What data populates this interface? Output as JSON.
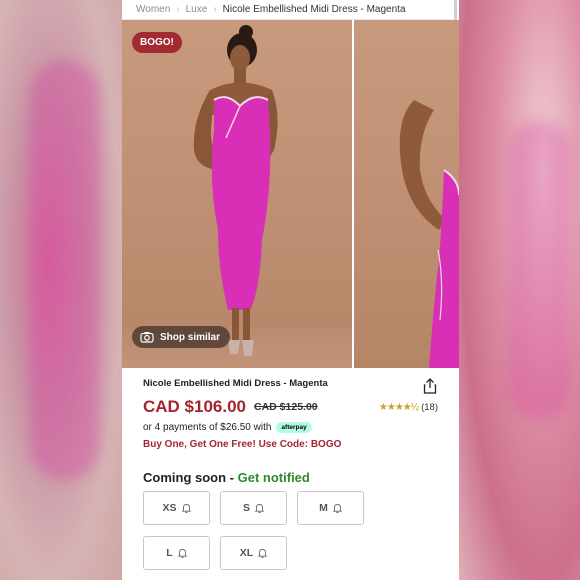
{
  "breadcrumb": {
    "items": [
      "Women",
      "Luxe"
    ],
    "current": "Nicole Embellished Midi Dress - Magenta"
  },
  "gallery": {
    "badge": "BOGO!",
    "shop_similar": "Shop similar"
  },
  "product": {
    "title": "Nicole Embellished Midi Dress - Magenta",
    "price": "CAD $106.00",
    "old_price": "CAD $125.00",
    "rating": 4.5,
    "reviews": "(18)",
    "installments_text": "or 4 payments of $26.50 with",
    "afterpay_label": "afterpay",
    "promo": "Buy One, Get One Free! Use Code: BOGO"
  },
  "availability": {
    "coming_soon": "Coming soon",
    "separator": "-",
    "get_notified": "Get notified"
  },
  "sizes": [
    "XS",
    "S",
    "M",
    "L",
    "XL"
  ],
  "colors": {
    "price_red": "#a3262e",
    "notify_green": "#2d8a2d",
    "dress_magenta": "#d92fb6",
    "star_gold": "#c9a227"
  }
}
